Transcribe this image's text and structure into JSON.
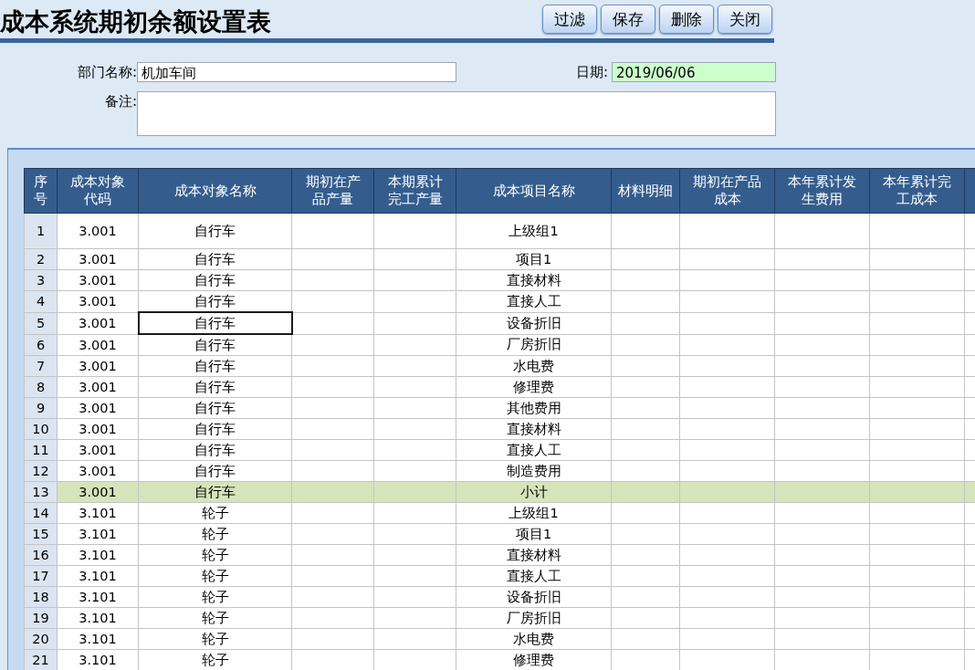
{
  "title": "成本系统期初余额设置表",
  "buttons": [
    "过滤",
    "保存",
    "删除",
    "关闭"
  ],
  "form": {
    "department": {
      "label": "部门名称:",
      "value": "机加车间"
    },
    "date": {
      "label": "日期:",
      "value": "2019/06/06"
    },
    "remark": {
      "label": "备注:"
    }
  },
  "table": {
    "columns": [
      "序号",
      "成本对象代码",
      "成本对象名称",
      "期初在产品产量",
      "本期累计完工产量",
      "成本项目名称",
      "材料明细",
      "期初在产品成本",
      "本年累计发生费用",
      "本年累计完工成本"
    ],
    "rows": [
      {
        "no": "1",
        "code": "3.001",
        "name": "自行车",
        "item": "上级组1",
        "kind": "item",
        "selected": false
      },
      {
        "no": "2",
        "code": "3.001",
        "name": "自行车",
        "item": "项目1",
        "kind": "item",
        "selected": false
      },
      {
        "no": "3",
        "code": "3.001",
        "name": "自行车",
        "item": "直接材料",
        "kind": "item",
        "selected": false
      },
      {
        "no": "4",
        "code": "3.001",
        "name": "自行车",
        "item": "直接人工",
        "kind": "item",
        "selected": false
      },
      {
        "no": "5",
        "code": "3.001",
        "name": "自行车",
        "item": "设备折旧",
        "kind": "item",
        "selected": true
      },
      {
        "no": "6",
        "code": "3.001",
        "name": "自行车",
        "item": "厂房折旧",
        "kind": "item",
        "selected": false
      },
      {
        "no": "7",
        "code": "3.001",
        "name": "自行车",
        "item": "水电费",
        "kind": "item",
        "selected": false
      },
      {
        "no": "8",
        "code": "3.001",
        "name": "自行车",
        "item": "修理费",
        "kind": "item",
        "selected": false
      },
      {
        "no": "9",
        "code": "3.001",
        "name": "自行车",
        "item": "其他费用",
        "kind": "item",
        "selected": false
      },
      {
        "no": "10",
        "code": "3.001",
        "name": "自行车",
        "item": "直接材料",
        "kind": "item",
        "selected": false
      },
      {
        "no": "11",
        "code": "3.001",
        "name": "自行车",
        "item": "直接人工",
        "kind": "item",
        "selected": false
      },
      {
        "no": "12",
        "code": "3.001",
        "name": "自行车",
        "item": "制造费用",
        "kind": "item",
        "selected": false
      },
      {
        "no": "13",
        "code": "3.001",
        "name": "自行车",
        "item": "小计",
        "kind": "subtotal",
        "selected": false
      },
      {
        "no": "14",
        "code": "3.101",
        "name": "轮子",
        "item": "上级组1",
        "kind": "item",
        "selected": false
      },
      {
        "no": "15",
        "code": "3.101",
        "name": "轮子",
        "item": "项目1",
        "kind": "item",
        "selected": false
      },
      {
        "no": "16",
        "code": "3.101",
        "name": "轮子",
        "item": "直接材料",
        "kind": "item",
        "selected": false
      },
      {
        "no": "17",
        "code": "3.101",
        "name": "轮子",
        "item": "直接人工",
        "kind": "item",
        "selected": false
      },
      {
        "no": "18",
        "code": "3.101",
        "name": "轮子",
        "item": "设备折旧",
        "kind": "item",
        "selected": false
      },
      {
        "no": "19",
        "code": "3.101",
        "name": "轮子",
        "item": "厂房折旧",
        "kind": "item",
        "selected": false
      },
      {
        "no": "20",
        "code": "3.101",
        "name": "轮子",
        "item": "水电费",
        "kind": "item",
        "selected": false
      },
      {
        "no": "21",
        "code": "3.101",
        "name": "轮子",
        "item": "修理费",
        "kind": "item",
        "selected": false
      }
    ]
  }
}
